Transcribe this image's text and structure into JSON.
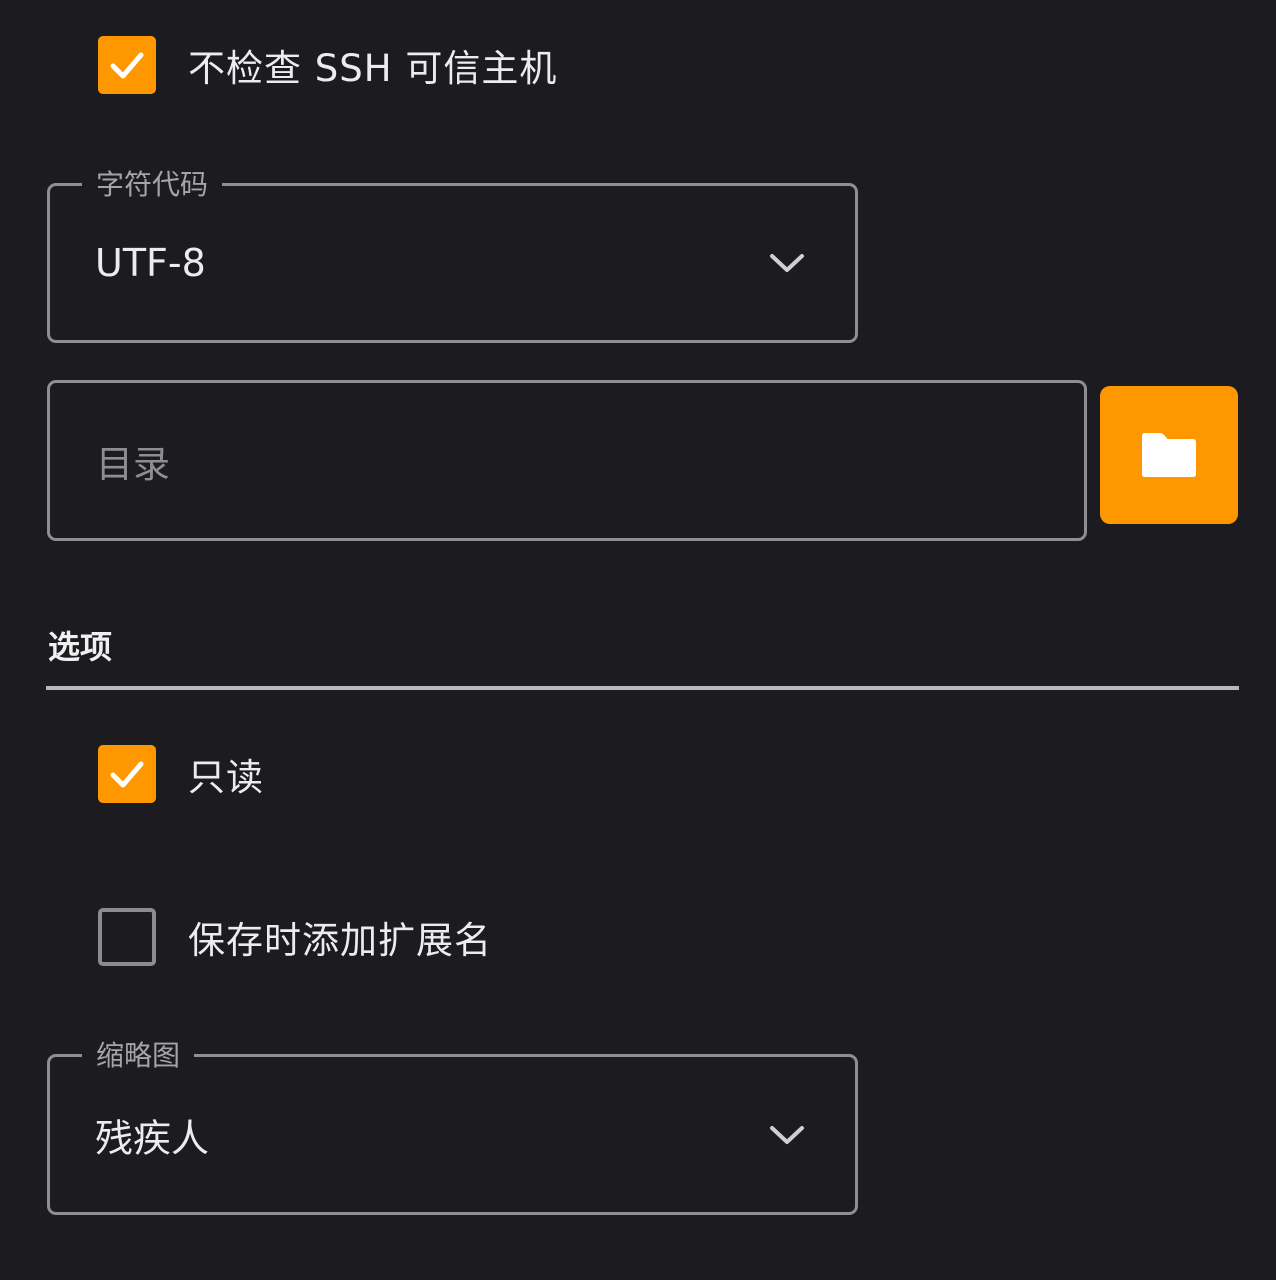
{
  "ssh_check": {
    "label": "不检查 SSH 可信主机",
    "checked": true
  },
  "encoding": {
    "label": "字符代码",
    "value": "UTF-8"
  },
  "directory": {
    "placeholder": "目录",
    "browse_icon": "folder-icon"
  },
  "options": {
    "title": "选项",
    "read_only": {
      "label": "只读",
      "checked": true
    },
    "add_extension": {
      "label": "保存时添加扩展名",
      "checked": false
    }
  },
  "thumbnail": {
    "label": "缩略图",
    "value": "残疾人"
  },
  "colors": {
    "accent": "#ff9800",
    "background": "#1c1c20"
  }
}
